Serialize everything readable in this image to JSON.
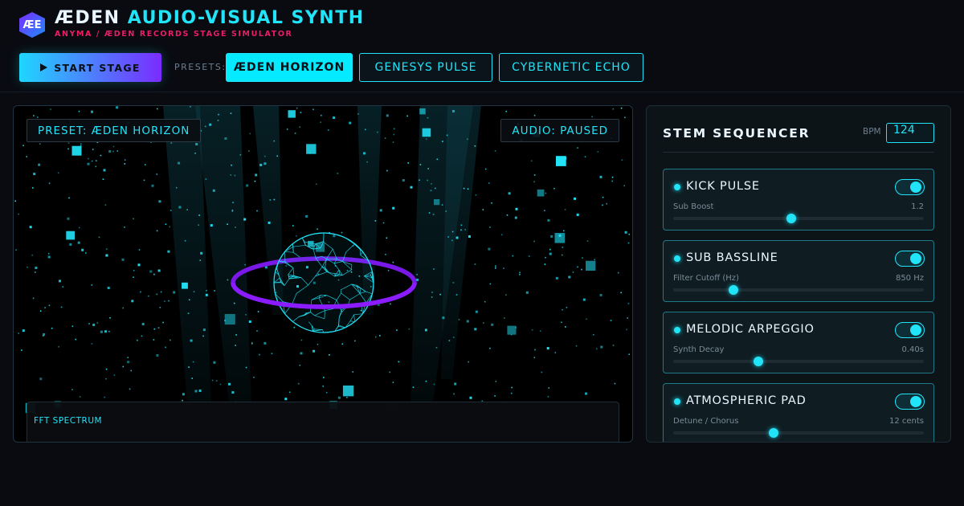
{
  "app": {
    "logo_text": "ÆE",
    "title_prefix": "ÆDEN",
    "title_accent": "AUDIO-VISUAL SYNTH",
    "subtitle": "ANYMA / ÆDEN RECORDS STAGE SIMULATOR"
  },
  "toolbar": {
    "start_label": "START STAGE",
    "presets_label": "PRESETS:",
    "presets": [
      {
        "label": "ÆDEN HORIZON",
        "active": true
      },
      {
        "label": "GENESYS PULSE",
        "active": false
      },
      {
        "label": "CYBERNETIC ECHO",
        "active": false
      }
    ]
  },
  "stage": {
    "preset_badge": "PRESET: ÆDEN HORIZON",
    "audio_badge": "AUDIO: PAUSED",
    "fft_label": "FFT SPECTRUM"
  },
  "sequencer": {
    "title": "STEM SEQUENCER",
    "bpm_label": "BPM",
    "bpm_value": "124",
    "stems": [
      {
        "name": "KICK PULSE",
        "enabled": true,
        "param_label": "Sub Boost",
        "param_value": "1.2",
        "level": 0.47
      },
      {
        "name": "SUB BASSLINE",
        "enabled": true,
        "param_label": "Filter Cutoff (Hz)",
        "param_value": "850 Hz",
        "level": 0.24
      },
      {
        "name": "MELODIC ARPEGGIO",
        "enabled": true,
        "param_label": "Synth Decay",
        "param_value": "0.40s",
        "level": 0.34
      },
      {
        "name": "ATMOSPHERIC PAD",
        "enabled": true,
        "param_label": "Detune / Chorus",
        "param_value": "12 cents",
        "level": 0.4
      }
    ]
  },
  "colors": {
    "accent": "#21e4f8",
    "brand_pink": "#e91e63",
    "ring": "#8a1cff",
    "background": "#090b11"
  }
}
